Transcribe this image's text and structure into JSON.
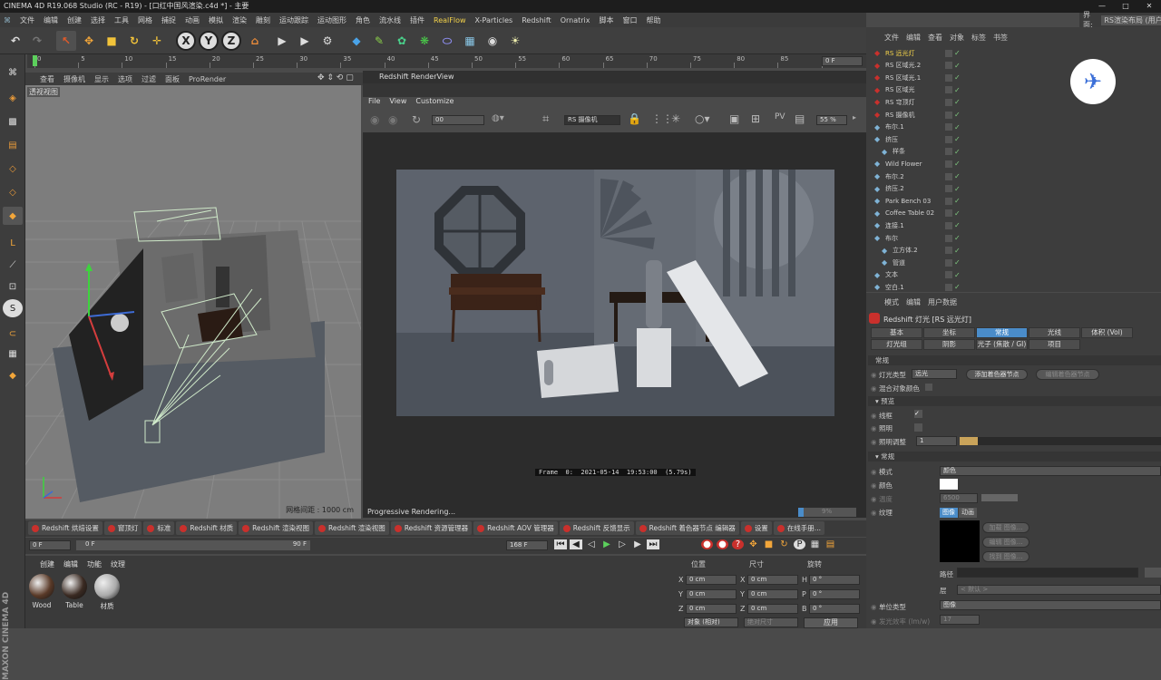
{
  "window": {
    "title": "CINEMA 4D R19.068 Studio (RC - R19) - [口红中国风渲染.c4d *] - 主要",
    "layout_label": "界面:",
    "layout_value": "RS渲染布局 (用户"
  },
  "menu": [
    "文件",
    "编辑",
    "创建",
    "选择",
    "工具",
    "网格",
    "捕捉",
    "动画",
    "模拟",
    "渲染",
    "雕刻",
    "运动跟踪",
    "运动图形",
    "角色",
    "流水线",
    "插件",
    "RealFlow",
    "X-Particles",
    "Redshift",
    "Ornatrix",
    "脚本",
    "窗口",
    "帮助"
  ],
  "timeline": {
    "ticks": [
      "0",
      "5",
      "10",
      "15",
      "20",
      "25",
      "30",
      "35",
      "40",
      "45",
      "50",
      "55",
      "60",
      "65",
      "70",
      "75",
      "80",
      "85",
      "90"
    ],
    "frame_field": "0 F"
  },
  "viewport": {
    "menu": [
      "查看",
      "摄像机",
      "显示",
      "选项",
      "过滤",
      "面板",
      "ProRender"
    ],
    "label": "透视视图",
    "grid_spacing": "网格间距 : 1000 cm"
  },
  "renderview": {
    "title": "Redshift RenderView",
    "menu": [
      "File",
      "View",
      "Customize"
    ],
    "snapshot": "00",
    "camera": "RS 摄像机",
    "zoom": "55 %",
    "frame_info": "Frame  0:  2021-05-14  19:53:00  (5.79s)",
    "status": "Progressive Rendering...",
    "progress_label": "9%",
    "progress": 0.09
  },
  "tabs": [
    "Redshift 烘焙设置",
    "窗顶灯",
    "标准",
    "Redshift 材质",
    "Redshift 渲染视图",
    "Redshift 渲染视图",
    "Redshift 资源管理器",
    "Redshift AOV 管理器",
    "Redshift 反馈显示",
    "Redshift 着色器节点 编辑器",
    "设置",
    "在线手册..."
  ],
  "anim": {
    "start": "0 F",
    "scrub_start": "0 F",
    "scrub_end": "90 F",
    "end": "168 F"
  },
  "materials": {
    "menu": [
      "创建",
      "编辑",
      "功能",
      "纹理"
    ],
    "items": [
      "Wood",
      "Table",
      "材质"
    ]
  },
  "coords": {
    "headers": [
      "位置",
      "尺寸",
      "旋转"
    ],
    "rows": [
      {
        "axis": "X",
        "pos": "0 cm",
        "size_axis": "X",
        "size": "0 cm",
        "rot_axis": "H",
        "rot": "0 °"
      },
      {
        "axis": "Y",
        "pos": "0 cm",
        "size_axis": "Y",
        "size": "0 cm",
        "rot_axis": "P",
        "rot": "0 °"
      },
      {
        "axis": "Z",
        "pos": "0 cm",
        "size_axis": "Z",
        "size": "0 cm",
        "rot_axis": "B",
        "rot": "0 °"
      }
    ],
    "mode": "对象 (相对)",
    "size_mode": "绝对尺寸",
    "apply": "应用"
  },
  "objects": {
    "menu": [
      "文件",
      "编辑",
      "查看",
      "对象",
      "标签",
      "书签"
    ],
    "rows": [
      {
        "name": "RS 远光灯",
        "indent": 0,
        "selected": true
      },
      {
        "name": "RS 区域光.2",
        "indent": 0
      },
      {
        "name": "RS 区域光.1",
        "indent": 0
      },
      {
        "name": "RS 区域光",
        "indent": 0
      },
      {
        "name": "RS 穹顶灯",
        "indent": 0
      },
      {
        "name": "RS 摄像机",
        "indent": 0
      },
      {
        "name": "布尔.1",
        "indent": 0
      },
      {
        "name": "挤压",
        "indent": 0
      },
      {
        "name": "样条",
        "indent": 1
      },
      {
        "name": "Wild Flower",
        "indent": 0
      },
      {
        "name": "布尔.2",
        "indent": 0
      },
      {
        "name": "挤压.2",
        "indent": 0
      },
      {
        "name": "Park Bench 03",
        "indent": 0
      },
      {
        "name": "Coffee Table 02",
        "indent": 0
      },
      {
        "name": "连接.1",
        "indent": 0
      },
      {
        "name": "布尔",
        "indent": 0
      },
      {
        "name": "立方体.2",
        "indent": 1
      },
      {
        "name": "管道",
        "indent": 1
      },
      {
        "name": "文本",
        "indent": 0
      },
      {
        "name": "空白.1",
        "indent": 0
      }
    ]
  },
  "attributes": {
    "menu": [
      "模式",
      "编辑",
      "用户数据"
    ],
    "title": "Redshift 灯光 [RS 远光灯]",
    "tabs_row1": [
      "基本",
      "坐标",
      "常规",
      "光线",
      "体积 (Vol)"
    ],
    "tabs_row2": [
      "灯光组",
      "阴影",
      "光子 (焦散 / GI)",
      "项目"
    ],
    "active_tab": "常规",
    "section_main": "常规",
    "light_type_label": "灯光类型",
    "light_type": "远光",
    "add_shader": "添加着色器节点",
    "edit_shader": "编辑着色器节点",
    "blend_label": "混合对象颜色",
    "preview_section": "预览",
    "wireframe_label": "线框",
    "illum_label": "照明",
    "illum_adjust_label": "照明调整",
    "illum_adjust": "1",
    "common_section": "常规",
    "mode_label": "模式",
    "mode": "颜色",
    "color_label": "颜色",
    "temp_label": "温度",
    "temp": "6500",
    "texture_label": "纹理",
    "tex_tabs": [
      "图像",
      "动画"
    ],
    "tex_buttons": [
      "加载 图像...",
      "编辑 图像...",
      "找到 图像..."
    ],
    "path_label": "路径",
    "layer_label": "层",
    "layer": "< 默认 >",
    "unit_label": "单位类型",
    "unit": "图像",
    "efficacy_label": "发光效率 (lm/w)",
    "efficacy": "17"
  },
  "colors": {
    "accent": "#4a8cc9",
    "selected_obj": "#f3d24a",
    "render_bg": "#5f6570"
  }
}
